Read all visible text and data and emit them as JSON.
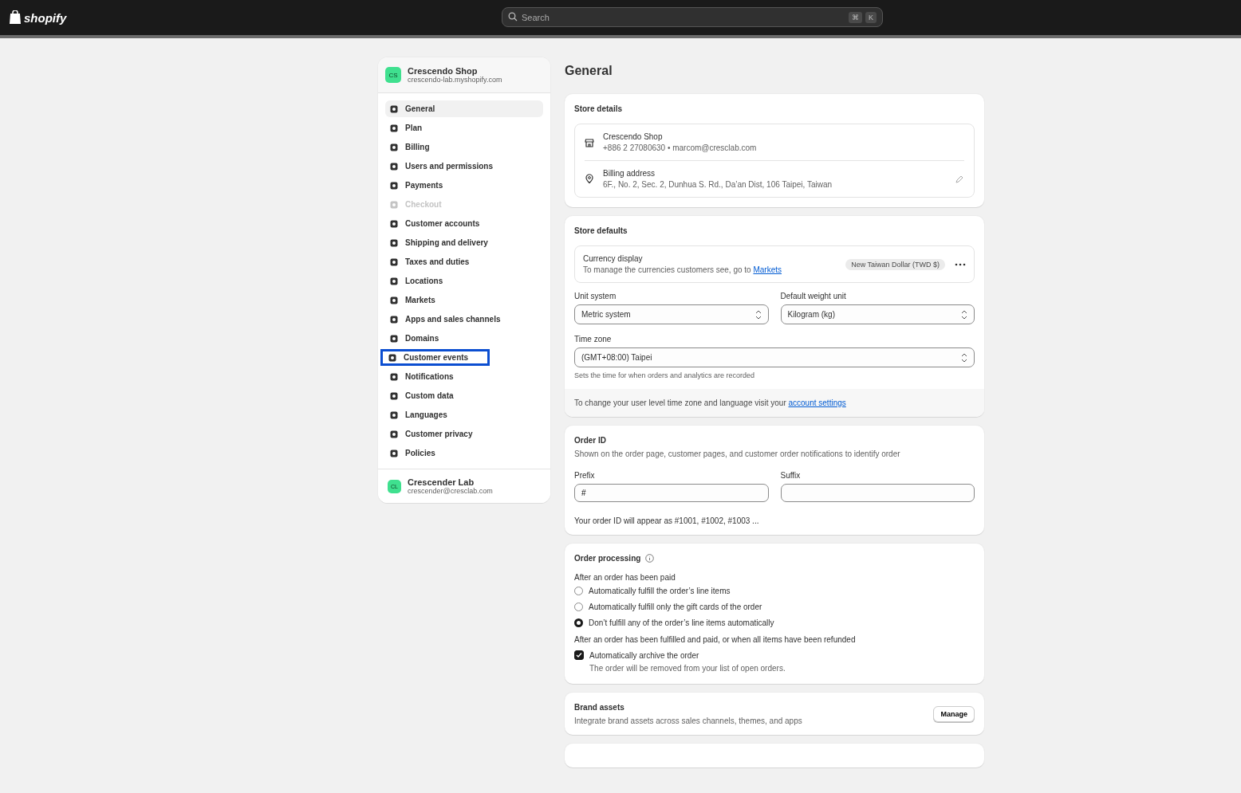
{
  "topbar": {
    "logo": "shopify",
    "search": {
      "placeholder": "Search",
      "keys": [
        "⌘",
        "K"
      ]
    }
  },
  "sidebar": {
    "store": {
      "initials": "CS",
      "name": "Crescendo Shop",
      "domain": "crescendo-lab.myshopify.com"
    },
    "items": [
      {
        "label": "General",
        "selected": true,
        "disabled": false,
        "highlighted": false
      },
      {
        "label": "Plan",
        "selected": false,
        "disabled": false,
        "highlighted": false
      },
      {
        "label": "Billing",
        "selected": false,
        "disabled": false,
        "highlighted": false
      },
      {
        "label": "Users and permissions",
        "selected": false,
        "disabled": false,
        "highlighted": false
      },
      {
        "label": "Payments",
        "selected": false,
        "disabled": false,
        "highlighted": false
      },
      {
        "label": "Checkout",
        "selected": false,
        "disabled": true,
        "highlighted": false
      },
      {
        "label": "Customer accounts",
        "selected": false,
        "disabled": false,
        "highlighted": false
      },
      {
        "label": "Shipping and delivery",
        "selected": false,
        "disabled": false,
        "highlighted": false
      },
      {
        "label": "Taxes and duties",
        "selected": false,
        "disabled": false,
        "highlighted": false
      },
      {
        "label": "Locations",
        "selected": false,
        "disabled": false,
        "highlighted": false
      },
      {
        "label": "Markets",
        "selected": false,
        "disabled": false,
        "highlighted": false
      },
      {
        "label": "Apps and sales channels",
        "selected": false,
        "disabled": false,
        "highlighted": false
      },
      {
        "label": "Domains",
        "selected": false,
        "disabled": false,
        "highlighted": false
      },
      {
        "label": "Customer events",
        "selected": false,
        "disabled": false,
        "highlighted": true
      },
      {
        "label": "Notifications",
        "selected": false,
        "disabled": false,
        "highlighted": false
      },
      {
        "label": "Custom data",
        "selected": false,
        "disabled": false,
        "highlighted": false
      },
      {
        "label": "Languages",
        "selected": false,
        "disabled": false,
        "highlighted": false
      },
      {
        "label": "Customer privacy",
        "selected": false,
        "disabled": false,
        "highlighted": false
      },
      {
        "label": "Policies",
        "selected": false,
        "disabled": false,
        "highlighted": false
      }
    ],
    "account": {
      "initials": "CL",
      "name": "Crescender Lab",
      "email": "crescender@cresclab.com"
    }
  },
  "page_title": "General",
  "store_details": {
    "title": "Store details",
    "name": "Crescendo Shop",
    "contact": "+886 2 27080630 • marcom@cresclab.com",
    "address_label": "Billing address",
    "address": "6F., No. 2, Sec. 2, Dunhua S. Rd., Da’an Dist, 106 Taipei, Taiwan"
  },
  "store_defaults": {
    "title": "Store defaults",
    "currency_label": "Currency display",
    "currency_help": "To manage the currencies customers see, go to",
    "currency_link": "Markets",
    "currency_badge": "New Taiwan Dollar (TWD $)",
    "unit_label": "Unit system",
    "unit_value": "Metric system",
    "weight_label": "Default weight unit",
    "weight_value": "Kilogram (kg)",
    "timezone_label": "Time zone",
    "timezone_value": "(GMT+08:00) Taipei",
    "timezone_help": "Sets the time for when orders and analytics are recorded",
    "footer_text": "To change your user level time zone and language visit your",
    "footer_link": "account settings"
  },
  "order_id": {
    "title": "Order ID",
    "description": "Shown on the order page, customer pages, and customer order notifications to identify order",
    "prefix_label": "Prefix",
    "prefix_value": "#",
    "suffix_label": "Suffix",
    "preview": "Your order ID will appear as #1001, #1002, #1003 ..."
  },
  "order_processing": {
    "title": "Order processing",
    "paid_label": "After an order has been paid",
    "options": [
      {
        "label": "Automatically fulfill the order’s line items",
        "selected": false
      },
      {
        "label": "Automatically fulfill only the gift cards of the order",
        "selected": false
      },
      {
        "label": "Don’t fulfill any of the order’s line items automatically",
        "selected": true
      }
    ],
    "fulfilled_label": "After an order has been fulfilled and paid, or when all items have been refunded",
    "archive": {
      "label": "Automatically archive the order",
      "checked": true,
      "help": "The order will be removed from your list of open orders."
    }
  },
  "brand_assets": {
    "title": "Brand assets",
    "description": "Integrate brand assets across sales channels, themes, and apps",
    "button": "Manage"
  }
}
